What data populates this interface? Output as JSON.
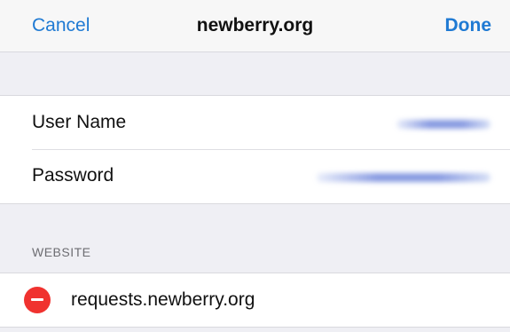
{
  "navbar": {
    "cancel_label": "Cancel",
    "title": "newberry.org",
    "done_label": "Done"
  },
  "credentials": {
    "username_label": "User Name",
    "username_value": "",
    "password_label": "Password",
    "password_value": ""
  },
  "website_section": {
    "header": "WEBSITE",
    "items": [
      {
        "label": "requests.newberry.org",
        "icon": "minus-circle-icon"
      }
    ]
  },
  "colors": {
    "accent": "#1f7ad3",
    "delete": "#f0322f",
    "background": "#efeff4"
  }
}
